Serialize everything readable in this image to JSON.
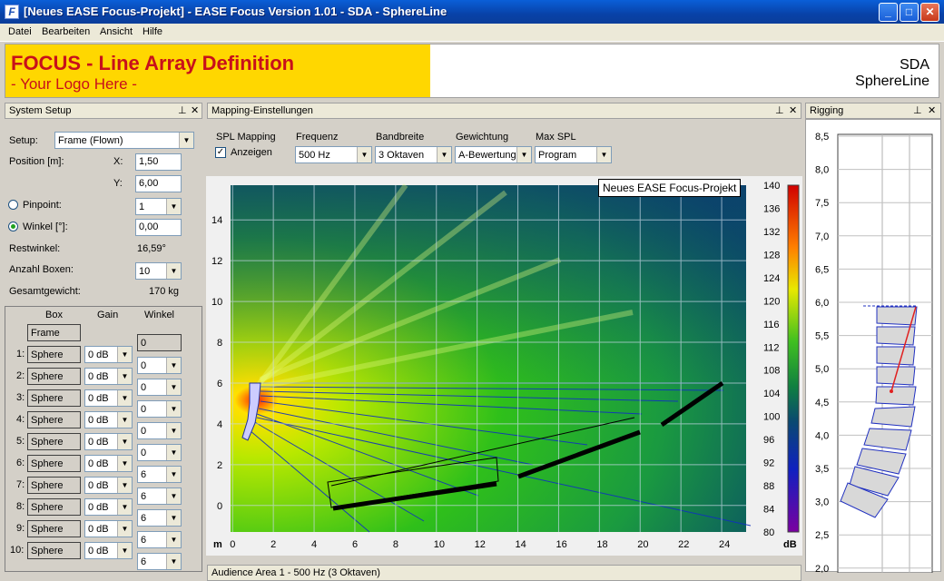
{
  "window": {
    "title": "[Neues EASE Focus-Projekt] - EASE Focus Version 1.01 - SDA - SphereLine"
  },
  "menu": [
    "Datei",
    "Bearbeiten",
    "Ansicht",
    "Hilfe"
  ],
  "banner": {
    "line1": "FOCUS - Line Array Definition",
    "line2": "- Your Logo Here -",
    "brand1": "SDA",
    "brand2": "SphereLine"
  },
  "panels": {
    "system": "System Setup",
    "mapping": "Mapping-Einstellungen",
    "rigging": "Rigging",
    "bottom": "Audience Area 1 - 500 Hz (3 Oktaven)"
  },
  "system": {
    "setup_label": "Setup:",
    "setup_value": "Frame (Flown)",
    "position_label": "Position [m]:",
    "x_label": "X:",
    "x_value": "1,50",
    "y_label": "Y:",
    "y_value": "6,00",
    "pinpoint_label": "Pinpoint:",
    "pinpoint_value": "1",
    "winkel_label": "Winkel [°]:",
    "winkel_value": "0,00",
    "rest_label": "Restwinkel:",
    "rest_value": "16,59°",
    "anzahl_label": "Anzahl Boxen:",
    "anzahl_value": "10",
    "gewicht_label": "Gesamtgewicht:",
    "gewicht_value": "170 kg"
  },
  "table": {
    "headers": [
      "Box",
      "Gain",
      "Winkel"
    ],
    "frame": "Frame",
    "frame_angle": "0",
    "rows": [
      {
        "n": "1:",
        "box": "Sphere",
        "gain": "0 dB",
        "angle": "0"
      },
      {
        "n": "2:",
        "box": "Sphere",
        "gain": "0 dB",
        "angle": "0"
      },
      {
        "n": "3:",
        "box": "Sphere",
        "gain": "0 dB",
        "angle": "0"
      },
      {
        "n": "4:",
        "box": "Sphere",
        "gain": "0 dB",
        "angle": "0"
      },
      {
        "n": "5:",
        "box": "Sphere",
        "gain": "0 dB",
        "angle": "0"
      },
      {
        "n": "6:",
        "box": "Sphere",
        "gain": "0 dB",
        "angle": "6"
      },
      {
        "n": "7:",
        "box": "Sphere",
        "gain": "0 dB",
        "angle": "6"
      },
      {
        "n": "8:",
        "box": "Sphere",
        "gain": "0 dB",
        "angle": "6"
      },
      {
        "n": "9:",
        "box": "Sphere",
        "gain": "0 dB",
        "angle": "6"
      },
      {
        "n": "10:",
        "box": "Sphere",
        "gain": "0 dB",
        "angle": "6"
      }
    ]
  },
  "mapping": {
    "spl_label": "SPL Mapping",
    "anzeigen_label": "Anzeigen",
    "freq_label": "Frequenz",
    "freq_value": "500 Hz",
    "band_label": "Bandbreite",
    "band_value": "3 Oktaven",
    "gew_label": "Gewichtung",
    "gew_value": "A-Bewertung",
    "max_label": "Max SPL",
    "max_value": "Program"
  },
  "tooltip": "Neues EASE Focus-Projekt",
  "plot": {
    "x_unit": "m",
    "x_ticks": [
      "0",
      "2",
      "4",
      "6",
      "8",
      "10",
      "12",
      "14",
      "16",
      "18",
      "20",
      "22",
      "24"
    ],
    "y_ticks": [
      "0",
      "2",
      "4",
      "6",
      "8",
      "10",
      "12",
      "14"
    ],
    "scale_unit": "dB",
    "scale_ticks": [
      "140",
      "136",
      "132",
      "128",
      "124",
      "120",
      "116",
      "112",
      "108",
      "104",
      "100",
      "96",
      "92",
      "88",
      "84",
      "80"
    ]
  },
  "rigging": {
    "y_ticks": [
      "8,5",
      "8,0",
      "7,5",
      "7,0",
      "6,5",
      "6,0",
      "5,5",
      "5,0",
      "4,5",
      "4,0",
      "3,5",
      "3,0",
      "2,5",
      "2,0"
    ]
  }
}
